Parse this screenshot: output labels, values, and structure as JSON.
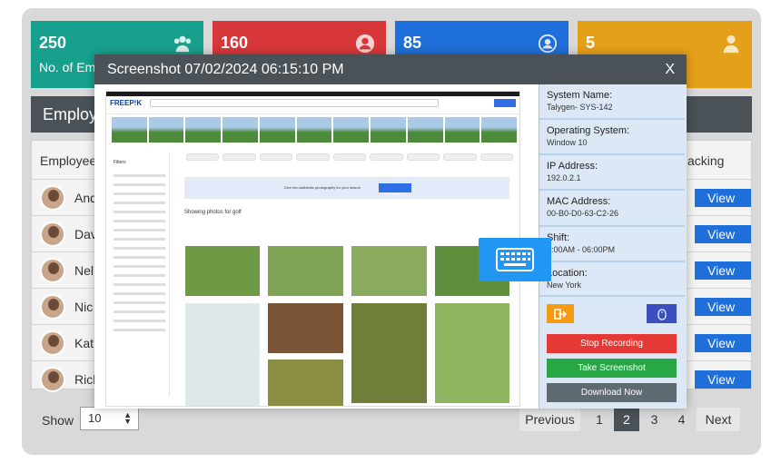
{
  "cards": [
    {
      "value": "250",
      "label": "No. of Em",
      "color": "#18a08e",
      "icon": "users-icon"
    },
    {
      "value": "160",
      "label": "",
      "color": "#d8373a",
      "icon": "user-circle-icon"
    },
    {
      "value": "85",
      "label": "",
      "color": "#1e6fd9",
      "icon": "user-circle-icon"
    },
    {
      "value": "5",
      "label": "",
      "color": "#e5a01a",
      "icon": "user-icon"
    }
  ],
  "section_title": "Employ",
  "table": {
    "headers": {
      "employee": "Employee",
      "tracking": "acking"
    },
    "rows": [
      {
        "name": "And",
        "action": "View"
      },
      {
        "name": "Dav",
        "action": "View"
      },
      {
        "name": "Nel",
        "action": "View"
      },
      {
        "name": "Nic",
        "action": "View"
      },
      {
        "name": "Kat",
        "action": "View"
      },
      {
        "name": "Rich",
        "action": "View"
      }
    ]
  },
  "pagination": {
    "show_label": "Show",
    "page_size": "10",
    "previous": "Previous",
    "pages": [
      "1",
      "2",
      "3",
      "4"
    ],
    "current": "2",
    "next": "Next"
  },
  "modal": {
    "title": "Screenshot 07/02/2024 06:15:10 PM",
    "close": "X",
    "info": [
      {
        "key": "System Name:",
        "value": "Talygen- SYS-142"
      },
      {
        "key": "Operating System:",
        "value": "Window 10"
      },
      {
        "key": "IP Address:",
        "value": "192.0.2.1"
      },
      {
        "key": "MAC Address:",
        "value": "00-B0-D0-63-C2-26"
      },
      {
        "key": "Shift:",
        "value": "9:00AM - 06:00PM"
      },
      {
        "key": "Location:",
        "value": "New York"
      }
    ],
    "buttons": {
      "stop": "Stop Recording",
      "take": "Take Screenshot",
      "download": "Download Now"
    }
  },
  "screenshot": {
    "logo": "FREEP!K",
    "banner_text": "Dive into authentic photography for your search",
    "banner_button": "Discover",
    "results_label": "Showing photos for golf",
    "filters_title": "Filters"
  }
}
